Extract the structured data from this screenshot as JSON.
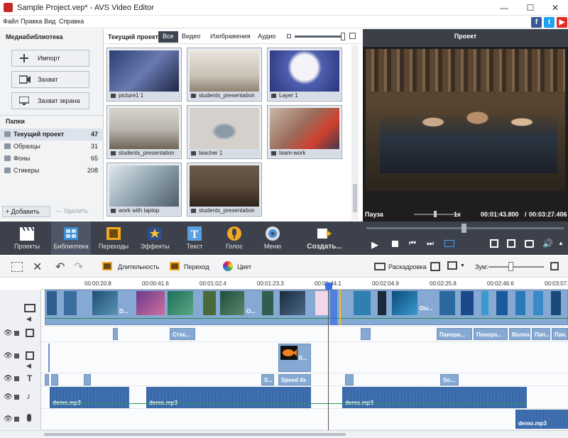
{
  "window": {
    "title": "Sample Project.vep* - AVS Video Editor",
    "minimize": "—",
    "maximize": "☐",
    "close": "✕"
  },
  "menu": [
    "Файл",
    "Правка",
    "Вид",
    "Справка"
  ],
  "social": {
    "fb": "f",
    "tw": "t",
    "yt": "▶",
    "fb_color": "#3b5998",
    "tw_color": "#1da1f2",
    "yt_color": "#e52d27"
  },
  "library": {
    "title": "Медиабиблиотека",
    "buttons": [
      {
        "label": "Импорт",
        "icon": "plus-icon"
      },
      {
        "label": "Захват",
        "icon": "camera-icon"
      },
      {
        "label": "Захват экрана",
        "icon": "monitor-icon"
      }
    ],
    "folders_title": "Папки",
    "folders": [
      {
        "name": "Текущий проект",
        "count": "47"
      },
      {
        "name": "Образцы",
        "count": "31"
      },
      {
        "name": "Фоны",
        "count": "65"
      },
      {
        "name": "Стикеры",
        "count": "208"
      }
    ],
    "add_label": "+ Добавить",
    "delete_label": "— Удалить"
  },
  "media": {
    "heading": "Текущий проект",
    "filters": [
      "Все",
      "Видео",
      "Изображения",
      "Аудио"
    ],
    "items": [
      {
        "name": "picture1 1",
        "color": "#4a5a8a"
      },
      {
        "name": "students_presentation",
        "color": "#c9c2b5"
      },
      {
        "name": "Layer 1",
        "color": "#4f5fb0"
      },
      {
        "name": "students_presentation",
        "color": "#b9b4ad"
      },
      {
        "name": "teacher 1",
        "color": "#d4d1cc"
      },
      {
        "name": "team-work",
        "color": "#9a6a5a"
      },
      {
        "name": "work with laptop",
        "color": "#8fa4b0"
      },
      {
        "name": "students_presentation",
        "color": "#5a4a3a"
      }
    ]
  },
  "preview": {
    "title": "Проект",
    "status": "Пауза",
    "speed": "1x",
    "current_time": "00:01:43.800",
    "total_time": "00:03:27.406",
    "progress": 0.5
  },
  "toolbar": [
    {
      "label": "Проекты",
      "icon": "clapper-icon"
    },
    {
      "label": "Библиотека",
      "icon": "library-icon"
    },
    {
      "label": "Переходы",
      "icon": "film-icon"
    },
    {
      "label": "Эффекты",
      "icon": "star-icon"
    },
    {
      "label": "Текст",
      "icon": "text-icon"
    },
    {
      "label": "Голос",
      "icon": "mic-icon"
    },
    {
      "label": "Меню",
      "icon": "disc-icon"
    },
    {
      "label": "Создать...",
      "icon": "create-icon"
    }
  ],
  "edit": {
    "duration": "Длительность",
    "transition": "Переход",
    "color": "Цвет",
    "storyboard": "Раскадровка",
    "zoom": "Зум:"
  },
  "timeline": {
    "ticks": [
      "00:00:20.8",
      "00:00:41.6",
      "00:01:02.4",
      "00:01:23.3",
      "00:01:44.1",
      "00:02:04.9",
      "00:02:25.8",
      "00:02:46.6",
      "00:03:07."
    ],
    "video_labels": [
      "D...",
      "O...",
      "Div..."
    ],
    "effects": [
      "Стек...",
      "Панора...",
      "Панора...",
      "Волна",
      "Пан...",
      "Пан..."
    ],
    "overlay": "fi...",
    "texts": [
      "S...",
      "Speed 4x",
      "So..."
    ],
    "audio": [
      "demo.mp3",
      "demo.mp3",
      "demo.mp3"
    ],
    "voice": [
      "demo.mp3"
    ]
  }
}
